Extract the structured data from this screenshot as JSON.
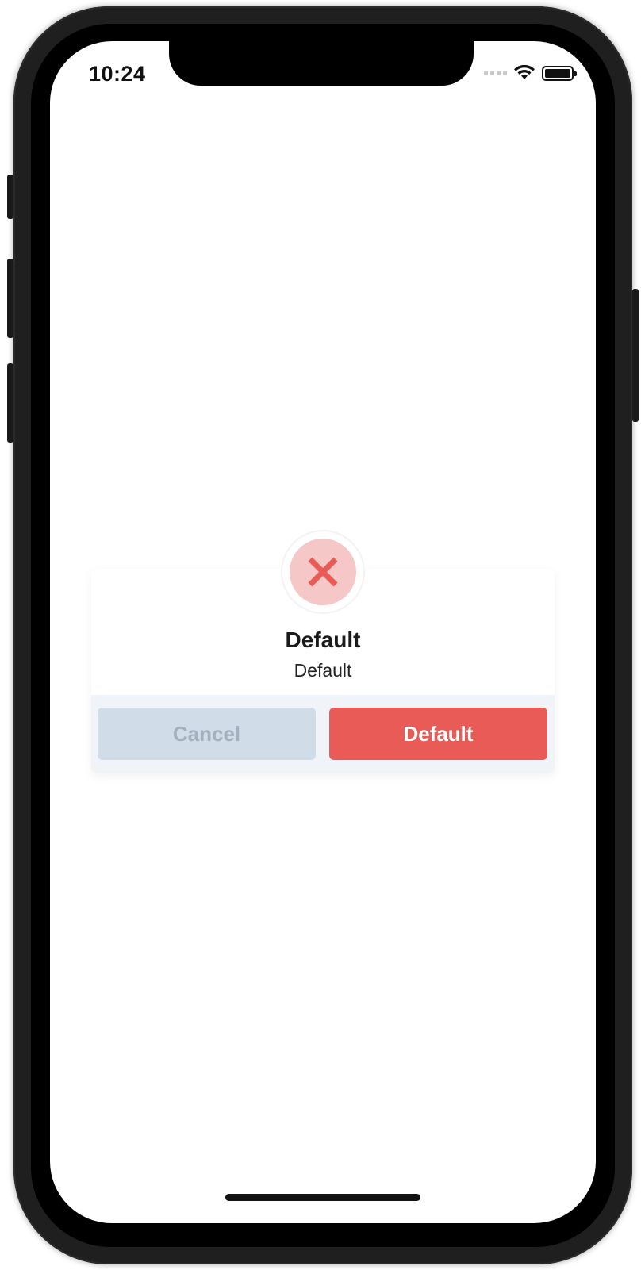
{
  "status_bar": {
    "time": "10:24",
    "icons": [
      "cellular-signal-icon",
      "wifi-icon",
      "battery-icon"
    ]
  },
  "alert": {
    "icon": "close-x-icon",
    "title": "Default",
    "message": "Default",
    "cancel_label": "Cancel",
    "confirm_label": "Default",
    "colors": {
      "icon_bg": "#f5c7c7",
      "icon_fg": "#e95b57",
      "confirm_bg": "#e95b57",
      "cancel_bg": "#d0dce8",
      "cancel_fg": "#a3b0be",
      "footer_bg": "#f0f4f8"
    }
  }
}
